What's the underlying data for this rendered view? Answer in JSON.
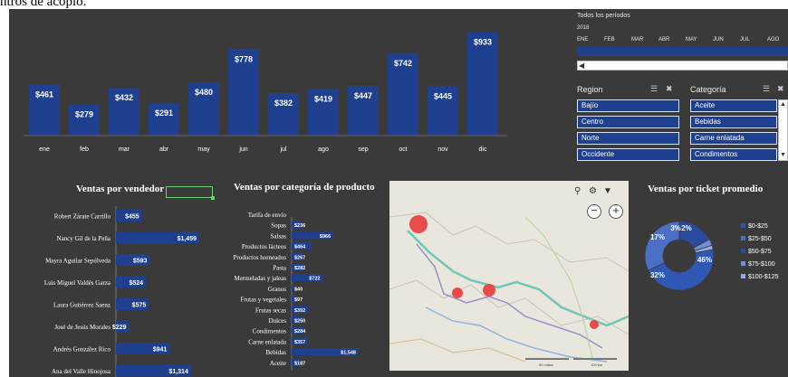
{
  "top_caption": "ntros de acopio.",
  "month_chart": {
    "type": "bar",
    "categories": [
      "ene",
      "feb",
      "mar",
      "abr",
      "may",
      "jun",
      "jul",
      "ago",
      "sep",
      "oct",
      "nov",
      "dic"
    ],
    "values": [
      461,
      279,
      432,
      291,
      480,
      778,
      382,
      419,
      447,
      742,
      445,
      933
    ],
    "data_labels": [
      "$461",
      "$279",
      "$432",
      "$291",
      "$480",
      "$778",
      "$382",
      "$419",
      "$447",
      "$742",
      "$445",
      "$933"
    ],
    "ylim": [
      0,
      1000
    ],
    "bar_color": "#1f3f8f"
  },
  "timeline": {
    "title": "Todos los períodos",
    "year": "2018",
    "months": [
      "ENE",
      "FEB",
      "MAR",
      "ABR",
      "MAY",
      "JUN",
      "JUL",
      "AGO"
    ],
    "scroll_arrow": "◀"
  },
  "region_slicer": {
    "title": "Region",
    "items": [
      "Bajío",
      "Centro",
      "Norte",
      "Occidente"
    ],
    "multiselect_icon": "☰",
    "clear_filter_icon": "✖"
  },
  "category_slicer": {
    "title": "Categoría",
    "items": [
      "Aceite",
      "Bebidas",
      "Carne enlatada",
      "Condimentos"
    ],
    "multiselect_icon": "☰",
    "clear_filter_icon": "✖",
    "scroll_up": "▲",
    "scroll_down": "▼"
  },
  "vendor_chart": {
    "title": "Ventas por vendedor",
    "type": "bar",
    "orientation": "horizontal",
    "categories": [
      "Robert Zárate Carrillo",
      "Nancy Gil de la Peña",
      "Mayra Aguilar Sepúlveda",
      "Luis Miguel Valdés Garza",
      "Laura Gutiérrez Saenz",
      "José de Jesús Morales",
      "Andrés González Rico",
      "Ana del Valle Hinojosa"
    ],
    "values": [
      455,
      1459,
      593,
      524,
      575,
      229,
      941,
      1314
    ],
    "data_labels": [
      "$455",
      "$1,459",
      "$593",
      "$524",
      "$575",
      "$229",
      "$941",
      "$1,314"
    ],
    "bar_color": "#1f3f8f"
  },
  "category_chart": {
    "title": "Ventas por categoría de producto",
    "type": "bar",
    "orientation": "horizontal",
    "categories": [
      "Tarifa de envío",
      "Sopas",
      "Salsas",
      "Productos lácteos",
      "Productos horneados",
      "Pasta",
      "Mermeladas y jaleas",
      "Granos",
      "Frutas y vegetales",
      "Frutas secas",
      "Dulces",
      "Condimentos",
      "Carne enlatada",
      "Bebidas",
      "Aceite"
    ],
    "values": [
      0,
      236,
      966,
      464,
      267,
      282,
      722,
      40,
      97,
      392,
      250,
      284,
      357,
      1548,
      187
    ],
    "data_labels": [
      "",
      "$236",
      "$966",
      "$464",
      "$267",
      "$282",
      "$722",
      "$40",
      "$97",
      "$392",
      "$250",
      "$284",
      "$357",
      "$1,548",
      "$187"
    ],
    "bar_color": "#1f3f8f"
  },
  "map": {
    "tool_icons": [
      "⚲",
      "⚙",
      "▼"
    ],
    "zoom_out": "−",
    "zoom_in": "+",
    "scale_labels": [
      "50 millas",
      "100 km"
    ]
  },
  "ticket_chart": {
    "title": "Ventas por ticket promedio",
    "type": "pie",
    "categories": [
      "$0-$25",
      "$25-$50",
      "$50-$75",
      "$75-$100",
      "$100-$125"
    ],
    "values": [
      46,
      32,
      17,
      3,
      2
    ],
    "data_labels": [
      "46%",
      "32%",
      "17%",
      "3%",
      "2%"
    ],
    "colors": [
      "#2f57b4",
      "#4a6fc4",
      "#2a4a9e",
      "#6f8fd6",
      "#93abe2"
    ]
  },
  "colors": {
    "background": "#3a3a3a",
    "accent": "#1f3f8f",
    "selection": "#6fd06f",
    "map_marker": "#e83a3a"
  }
}
